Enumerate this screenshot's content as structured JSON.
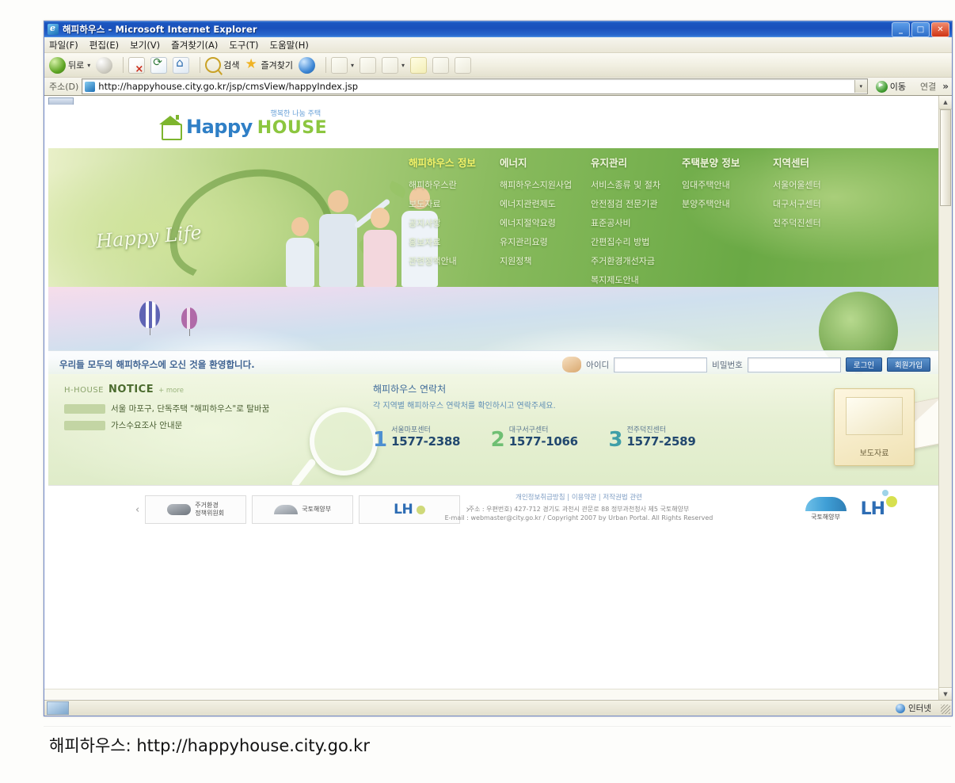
{
  "browser": {
    "title": "해피하우스 - Microsoft Internet Explorer",
    "window_buttons": {
      "minimize": "_",
      "maximize": "□",
      "close": "✕"
    },
    "menu": [
      "파일(F)",
      "편집(E)",
      "보기(V)",
      "즐겨찾기(A)",
      "도구(T)",
      "도움말(H)"
    ],
    "toolbar": {
      "back": "뒤로",
      "forward": "",
      "stop": "",
      "refresh": "",
      "home": "",
      "search": "검색",
      "favorites": "즐겨찾기",
      "dropdown_caret": "▾"
    },
    "address": {
      "label": "주소(D)",
      "url": "http://happyhouse.city.go.kr/jsp/cmsView/happyIndex.jsp",
      "dropdown": "▾",
      "go_label": "이동",
      "links_label": "연결",
      "chevron": "»"
    },
    "status": {
      "zone": "인터넷"
    }
  },
  "site": {
    "logo": {
      "happy": "Happy",
      "house": "HOUSE",
      "korean_tag": "행복한 나눔 주택"
    },
    "hero": {
      "tagline": "Happy Life",
      "nav": [
        {
          "head": "해피하우스 정보",
          "items": [
            "해피하우스란",
            "보도자료",
            "공지사항",
            "홍보자료",
            "관련정책안내"
          ]
        },
        {
          "head": "에너지",
          "items": [
            "해피하우스지원사업",
            "에너지관련제도",
            "에너지절약요령",
            "유지관리요령",
            "지원정책"
          ]
        },
        {
          "head": "유지관리",
          "items": [
            "서비스종류 및 절차",
            "안전점검 전문기관",
            "표준공사비",
            "간편집수리 방법",
            "주거환경개선자금",
            "복지제도안내"
          ]
        },
        {
          "head": "주택분양 정보",
          "items": [
            "임대주택안내",
            "분양주택안내"
          ]
        },
        {
          "head": "지역센터",
          "items": [
            "서울어울센터",
            "대구서구센터",
            "전주덕진센터"
          ]
        }
      ]
    },
    "login": {
      "welcome": "우리들 모두의 해피하우스에 오신 것을 환영합니다.",
      "id_label": "아이디",
      "id_value": "",
      "pw_label": "비밀번호",
      "pw_value": "",
      "login_button": "로그인",
      "signup_button": "회원가입"
    },
    "notice": {
      "brand": "H-HOUSE",
      "heading": "NOTICE",
      "more": "+ more",
      "rows": [
        {
          "title": "서울 마포구, 단독주택 \"해피하우스\"로 탈바꿈"
        },
        {
          "title": "가스수요조사 안내문"
        }
      ]
    },
    "contact": {
      "title": "해피하우스 연락처",
      "subtitle": "각 지역별 해피하우스 연락처를 확인하시고 연락주세요.",
      "centers": [
        {
          "num": "1",
          "name": "서울마포센터",
          "phone": "1577-2388"
        },
        {
          "num": "2",
          "name": "대구서구센터",
          "phone": "1577-1066"
        },
        {
          "num": "3",
          "name": "전주덕진센터",
          "phone": "1577-2589"
        }
      ],
      "press_label": "보도자료"
    },
    "footer": {
      "prev_arrow": "‹",
      "next_arrow": "›",
      "banners": [
        {
          "line1": "주거환경",
          "line2": "정책위원회"
        },
        {
          "line1": "국토해양부",
          "line2": ""
        },
        {
          "line1": "LH",
          "line2": ""
        }
      ],
      "links": "개인정보취급방침  |  이용약관  |  저작권법 관련",
      "address": "주소 : 우편번호) 427-712 경기도 과천시 관문로 88 정부과천청사 제5 국토해양부",
      "email_line": "E-mail : webmaster@city.go.kr  /  Copyright 2007 by Urban Portal. All Rights Reserved",
      "gov_name": "국토해양부",
      "lh_name": "LH"
    }
  },
  "caption": "해피하우스: http://happyhouse.city.go.kr"
}
